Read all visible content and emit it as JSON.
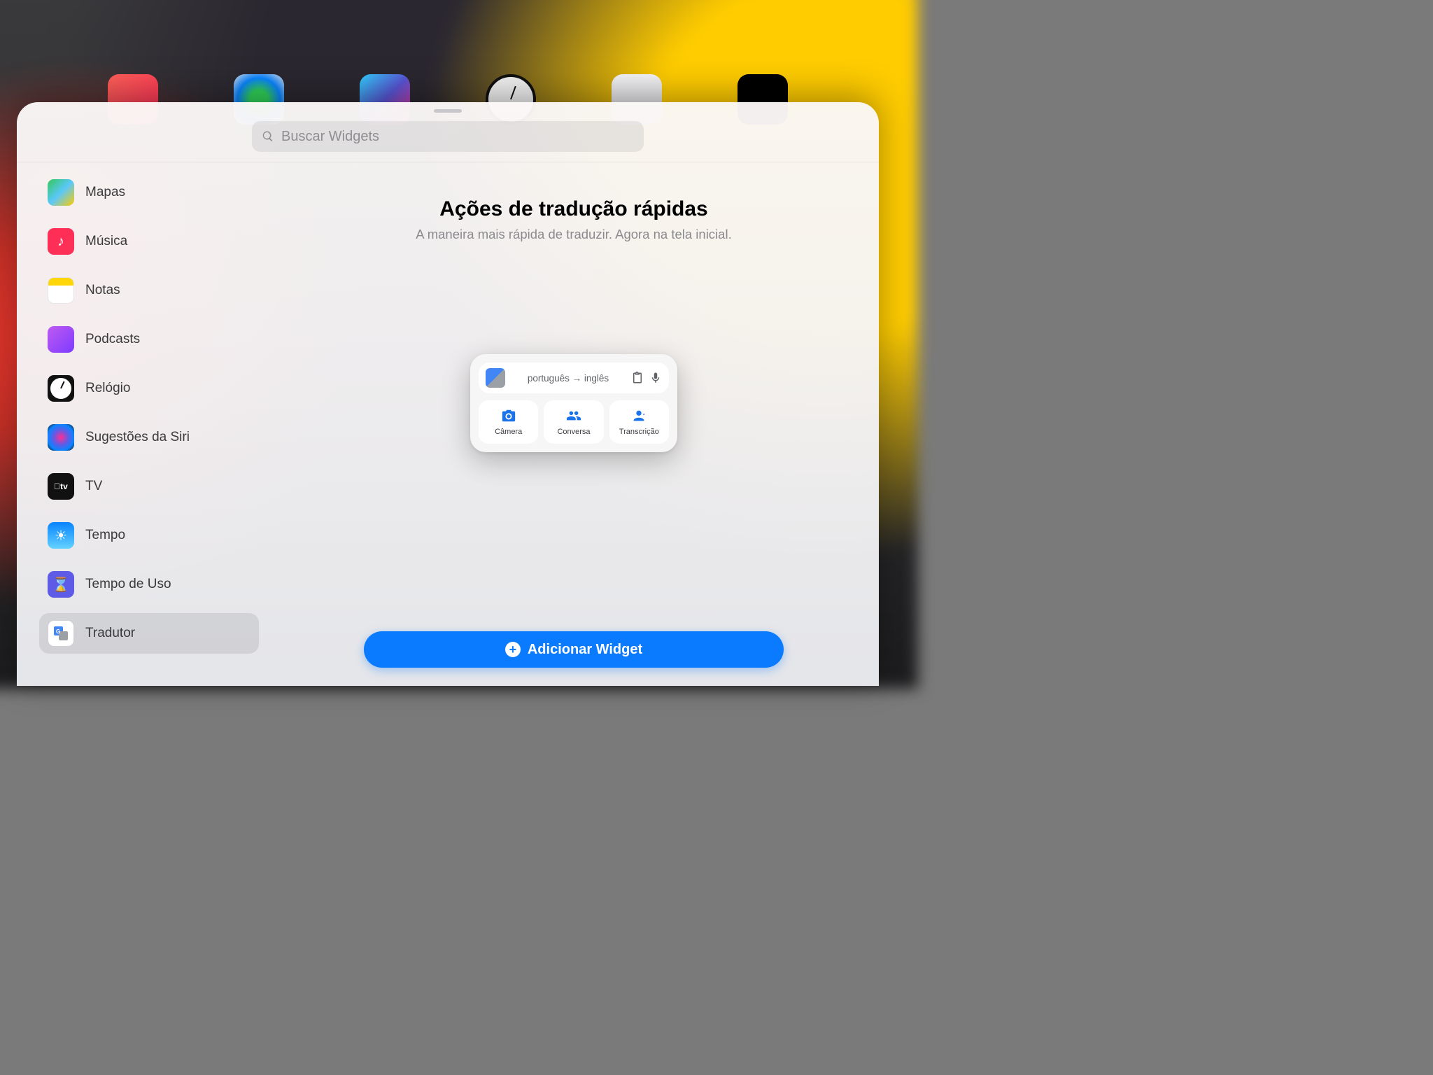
{
  "search": {
    "placeholder": "Buscar Widgets"
  },
  "sidebar": {
    "items": [
      {
        "id": "maps",
        "label": "Mapas"
      },
      {
        "id": "music",
        "label": "Música"
      },
      {
        "id": "notes",
        "label": "Notas"
      },
      {
        "id": "podcasts",
        "label": "Podcasts"
      },
      {
        "id": "clock",
        "label": "Relógio"
      },
      {
        "id": "siri",
        "label": "Sugestões da Siri"
      },
      {
        "id": "tv",
        "label": "TV"
      },
      {
        "id": "weather",
        "label": "Tempo"
      },
      {
        "id": "screentime",
        "label": "Tempo de Uso"
      },
      {
        "id": "translator",
        "label": "Tradutor"
      }
    ],
    "selected_id": "translator",
    "tv_glyph": "tv"
  },
  "content": {
    "title": "Ações de tradução rápidas",
    "subtitle": "A maneira mais rápida de traduzir. Agora na tela inicial."
  },
  "widget_preview": {
    "language_pair": "português → inglês",
    "actions": [
      {
        "id": "camera",
        "label": "Câmera"
      },
      {
        "id": "conversation",
        "label": "Conversa"
      },
      {
        "id": "transcription",
        "label": "Transcrição"
      }
    ]
  },
  "add_button": {
    "label": "Adicionar Widget"
  },
  "colors": {
    "accent": "#0a7bff",
    "google_blue": "#1a73e8"
  }
}
